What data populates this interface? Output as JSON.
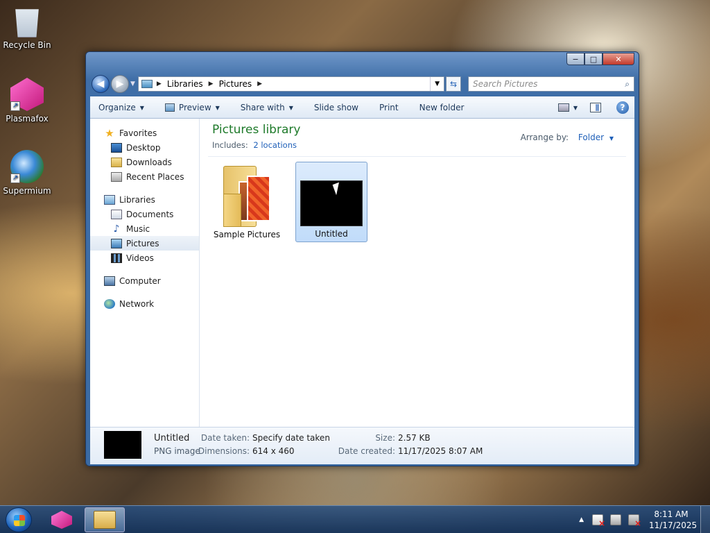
{
  "desktop": {
    "icons": [
      {
        "label": "Recycle Bin",
        "icon": "recycle-bin-icon"
      },
      {
        "label": "Plasmafox",
        "icon": "plasmafox-icon"
      },
      {
        "label": "Supermium",
        "icon": "supermium-icon"
      }
    ]
  },
  "window": {
    "controls": {
      "minimize": "−",
      "maximize": "□",
      "close": "✕"
    },
    "address": {
      "crumbs": [
        "Libraries",
        "Pictures"
      ]
    },
    "search": {
      "placeholder": "Search Pictures"
    },
    "toolbar": {
      "organize": "Organize",
      "preview": "Preview",
      "share_with": "Share with",
      "slide_show": "Slide show",
      "print": "Print",
      "new_folder": "New folder",
      "help": "?"
    },
    "nav": {
      "favorites": "Favorites",
      "desktop": "Desktop",
      "downloads": "Downloads",
      "recent_places": "Recent Places",
      "libraries": "Libraries",
      "documents": "Documents",
      "music": "Music",
      "pictures": "Pictures",
      "videos": "Videos",
      "computer": "Computer",
      "network": "Network"
    },
    "library": {
      "title": "Pictures library",
      "includes_label": "Includes:",
      "includes_link": "2 locations",
      "arrange_label": "Arrange by:",
      "arrange_value": "Folder"
    },
    "items": [
      {
        "label": "Sample Pictures",
        "type": "folder"
      },
      {
        "label": "Untitled",
        "type": "image",
        "selected": true
      }
    ],
    "details": {
      "name": "Untitled",
      "type": "PNG image",
      "date_taken_label": "Date taken:",
      "date_taken_value": "Specify date taken",
      "dimensions_label": "Dimensions:",
      "dimensions_value": "614 x 460",
      "size_label": "Size:",
      "size_value": "2.57 KB",
      "date_created_label": "Date created:",
      "date_created_value": "11/17/2025 8:07 AM"
    }
  },
  "taskbar": {
    "clock_time": "8:11 AM",
    "clock_date": "11/17/2025"
  }
}
